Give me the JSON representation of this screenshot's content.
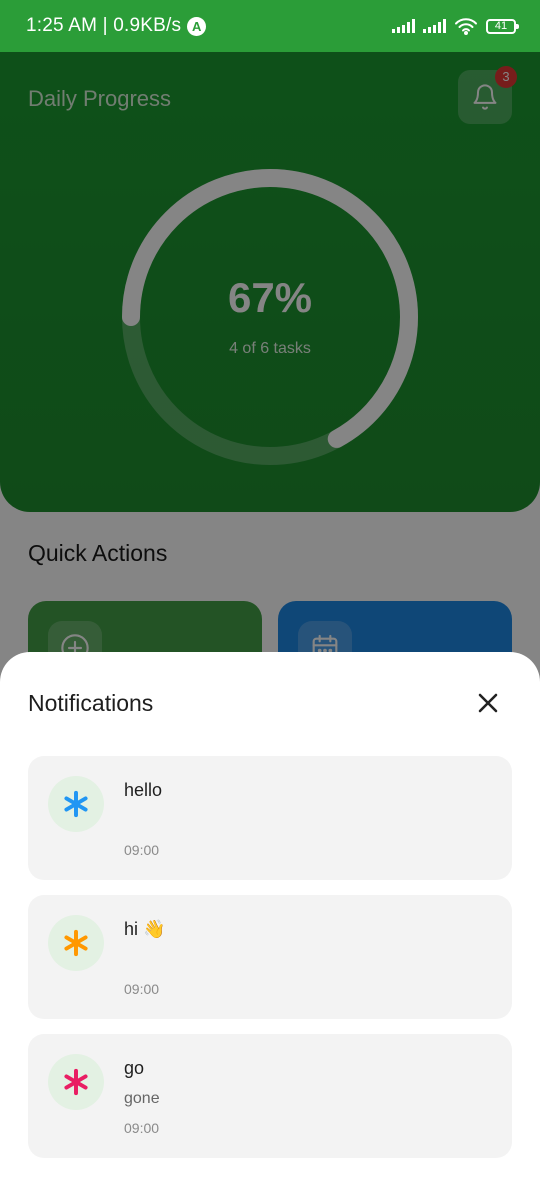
{
  "status_bar": {
    "time_speed": "1:25 AM | 0.9KB/s",
    "app_badge": "A",
    "battery": "41"
  },
  "header": {
    "title": "Daily Progress",
    "badge_count": "3"
  },
  "progress": {
    "percent_label": "67%",
    "fraction": 0.67,
    "subtitle": "4 of 6 tasks"
  },
  "quick_actions": {
    "title": "Quick Actions"
  },
  "notifications": {
    "title": "Notifications",
    "items": [
      {
        "title": "hello",
        "body": "",
        "time": "09:00",
        "icon_color": "#2196f3"
      },
      {
        "title": "hi 👋",
        "body": "",
        "time": "09:00",
        "icon_color": "#ff9800"
      },
      {
        "title": "go",
        "body": "gone",
        "time": "09:00",
        "icon_color": "#e91e63"
      }
    ]
  },
  "colors": {
    "brand_green": "#2b9d38",
    "card_green": "#43a047",
    "card_blue": "#1e88e5"
  }
}
